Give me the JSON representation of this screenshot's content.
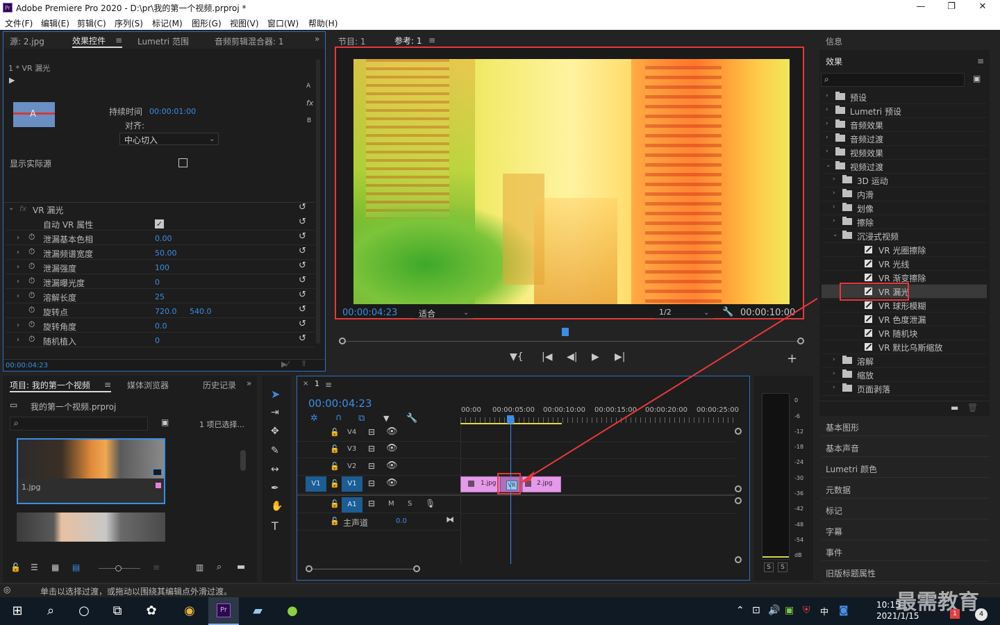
{
  "window": {
    "title": "Adobe Premiere Pro 2020 - D:\\pr\\我的第一个视频.prproj *",
    "app_icon_text": "Pr",
    "minimize": "—",
    "restore": "❐",
    "close": "✕"
  },
  "menu": [
    "文件(F)",
    "编辑(E)",
    "剪辑(C)",
    "序列(S)",
    "标记(M)",
    "图形(G)",
    "视图(V)",
    "窗口(W)",
    "帮助(H)"
  ],
  "source_panel": {
    "tabs": [
      "源: 2.jpg",
      "效果控件",
      "Lumetri 范围",
      "音频剪辑混合器: 1"
    ],
    "active_tab": "效果控件",
    "tab_menu_glyph": "≡",
    "overflow_glyph": "»",
    "clip_label": "1 * VR 漏光",
    "side_letters": [
      "A",
      "fx",
      "B"
    ],
    "duration_label": "持续时间",
    "duration_value": "00:00:01:00",
    "align_label": "对齐:",
    "align_value": "中心切入",
    "show_source_label": "显示实际源",
    "effect_fx": "fx",
    "effect_name": "VR 漏光",
    "props": [
      {
        "name": "自动 VR 属性",
        "value": "",
        "checkbox": true
      },
      {
        "name": "泄漏基本色相",
        "value": "0.00"
      },
      {
        "name": "泄漏频谱宽度",
        "value": "50.00"
      },
      {
        "name": "泄漏强度",
        "value": "100"
      },
      {
        "name": "泄漏曝光度",
        "value": "0"
      },
      {
        "name": "溶解长度",
        "value": "25"
      },
      {
        "name": "旋转点",
        "value": "720.0",
        "value2": "540.0"
      },
      {
        "name": "旋转角度",
        "value": "0.0"
      },
      {
        "name": "随机植入",
        "value": "0"
      }
    ],
    "timecode": "00:00:04:23"
  },
  "program_panel": {
    "tabs": [
      "节目: 1",
      "参考: 1"
    ],
    "active_tab": "参考: 1",
    "tab_menu_glyph": "≡",
    "timecode": "00:00:04:23",
    "fit_value": "适合",
    "quality_value": "1/2",
    "duration": "00:00:10:00",
    "controls": [
      "marker-button",
      "go-to-in-button",
      "step-back-button",
      "play-button",
      "go-to-out-button"
    ],
    "control_glyphs": [
      "▼{",
      "|◀",
      "◀|",
      "▶",
      "▶|"
    ],
    "add_glyph": "+",
    "settings_glyph": "🔧"
  },
  "project_panel": {
    "tabs": [
      "项目: 我的第一个视频",
      "媒体浏览器",
      "历史记录"
    ],
    "active_tab": "项目: 我的第一个视频",
    "tab_menu_glyph": "≡",
    "overflow_glyph": "»",
    "project_file": "我的第一个视频.prproj",
    "selection_count": "1 项已选择...",
    "items": [
      "1.jpg"
    ]
  },
  "tools": [
    "selection-tool",
    "track-select-tool",
    "ripple-edit-tool",
    "razor-tool",
    "slip-tool",
    "pen-tool",
    "hand-tool",
    "type-tool"
  ],
  "tool_glyphs": [
    "➤",
    "⇥",
    "✥",
    "✎",
    "↔",
    "✒",
    "✋",
    "T"
  ],
  "timeline": {
    "tab_label": "1",
    "close_glyph": "×",
    "tab_menu_glyph": "≡",
    "timecode": "00:00:04:23",
    "ruler": [
      "00:00",
      "00:00:05:00",
      "00:00:10:00",
      "00:00:15:00",
      "00:00:20:00",
      "00:00:25:00"
    ],
    "video_tracks": [
      "V4",
      "V3",
      "V2",
      "V1"
    ],
    "active_source_track": "V1",
    "audio_track": "A1",
    "audio_buttons": [
      "M",
      "S"
    ],
    "master_label": "主声道",
    "master_value": "0.0",
    "clips": [
      {
        "name": "1.jpg"
      },
      {
        "name": "VR"
      },
      {
        "name": "2.jpg"
      }
    ]
  },
  "meter": {
    "scale": [
      "0",
      "-6",
      "-12",
      "-18",
      "-24",
      "-30",
      "-36",
      "-42",
      "-48",
      "-54",
      "dB"
    ],
    "solo": [
      "S",
      "S"
    ]
  },
  "effects_panel": {
    "info_tab": "信息",
    "title": "效果",
    "menu_glyph": "≡",
    "tree": [
      {
        "label": "预设",
        "level": 0,
        "type": "folder",
        "arrow": "›"
      },
      {
        "label": "Lumetri 预设",
        "level": 0,
        "type": "folder",
        "arrow": "›"
      },
      {
        "label": "音频效果",
        "level": 0,
        "type": "folder",
        "arrow": "›"
      },
      {
        "label": "音频过渡",
        "level": 0,
        "type": "folder",
        "arrow": "›"
      },
      {
        "label": "视频效果",
        "level": 0,
        "type": "folder",
        "arrow": "›"
      },
      {
        "label": "视频过渡",
        "level": 0,
        "type": "folder",
        "arrow": "⌄"
      },
      {
        "label": "3D 运动",
        "level": 1,
        "type": "folder",
        "arrow": "›"
      },
      {
        "label": "内滑",
        "level": 1,
        "type": "folder",
        "arrow": "›"
      },
      {
        "label": "划像",
        "level": 1,
        "type": "folder",
        "arrow": "›"
      },
      {
        "label": "擦除",
        "level": 1,
        "type": "folder",
        "arrow": "›"
      },
      {
        "label": "沉浸式视频",
        "level": 1,
        "type": "folder",
        "arrow": "⌄"
      },
      {
        "label": "VR 光圈擦除",
        "level": 2,
        "type": "effect",
        "arrow": ""
      },
      {
        "label": "VR 光线",
        "level": 2,
        "type": "effect",
        "arrow": ""
      },
      {
        "label": "VR 渐变擦除",
        "level": 2,
        "type": "effect",
        "arrow": ""
      },
      {
        "label": "VR 漏光",
        "level": 2,
        "type": "effect",
        "arrow": "",
        "selected": true
      },
      {
        "label": "VR 球形模糊",
        "level": 2,
        "type": "effect",
        "arrow": ""
      },
      {
        "label": "VR 色度泄漏",
        "level": 2,
        "type": "effect",
        "arrow": ""
      },
      {
        "label": "VR 随机块",
        "level": 2,
        "type": "effect",
        "arrow": ""
      },
      {
        "label": "VR 默比乌斯缩放",
        "level": 2,
        "type": "effect",
        "arrow": ""
      },
      {
        "label": "溶解",
        "level": 1,
        "type": "folder",
        "arrow": "›"
      },
      {
        "label": "缩放",
        "level": 1,
        "type": "folder",
        "arrow": "›"
      },
      {
        "label": "页面剥落",
        "level": 1,
        "type": "folder",
        "arrow": "›"
      }
    ],
    "side_panels": [
      "基本图形",
      "基本声音",
      "Lumetri 颜色",
      "元数据",
      "标记",
      "字幕",
      "事件",
      "旧版标题属性"
    ]
  },
  "status_bar": {
    "text": "单击以选择过渡，或拖动以围绕其编辑点外滑过渡。"
  },
  "taskbar": {
    "time": "10:15",
    "date": "2021/1/15",
    "ime": "中",
    "watermark": "最需教育",
    "notification_badge": "1",
    "action_badge": "4"
  }
}
